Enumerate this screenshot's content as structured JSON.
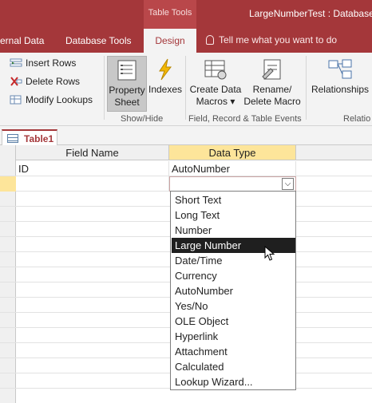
{
  "window": {
    "context_group": "Table Tools",
    "title": "LargeNumberTest : Database-"
  },
  "tabs": {
    "external_data": "ernal Data",
    "database_tools": "Database Tools",
    "design": "Design",
    "tell_me": "Tell me what you want to do"
  },
  "ribbon": {
    "insert_rows": "Insert Rows",
    "delete_rows": "Delete Rows",
    "modify_lookups": "Modify Lookups",
    "property_sheet_1": "Property",
    "property_sheet_2": "Sheet",
    "indexes": "Indexes",
    "create_data_macros_1": "Create Data",
    "create_data_macros_2": "Macros ▾",
    "rename_delete_macro_1": "Rename/",
    "rename_delete_macro_2": "Delete Macro",
    "relationships": "Relationships",
    "group_show_hide": "Show/Hide",
    "group_field_record": "Field, Record & Table Events",
    "group_relationships": "Relatio"
  },
  "document": {
    "tab": "Table1"
  },
  "grid": {
    "col_field_name": "Field Name",
    "col_data_type": "Data Type",
    "row1_field": "ID",
    "row1_type": "AutoNumber"
  },
  "dropdown": {
    "selected_index": 3,
    "options": [
      "Short Text",
      "Long Text",
      "Number",
      "Large Number",
      "Date/Time",
      "Currency",
      "AutoNumber",
      "Yes/No",
      "OLE Object",
      "Hyperlink",
      "Attachment",
      "Calculated",
      "Lookup Wizard..."
    ]
  },
  "colors": {
    "accent": "#a4373a",
    "header_highlight": "#fde59a",
    "selected_option": "#1f1f1f"
  }
}
